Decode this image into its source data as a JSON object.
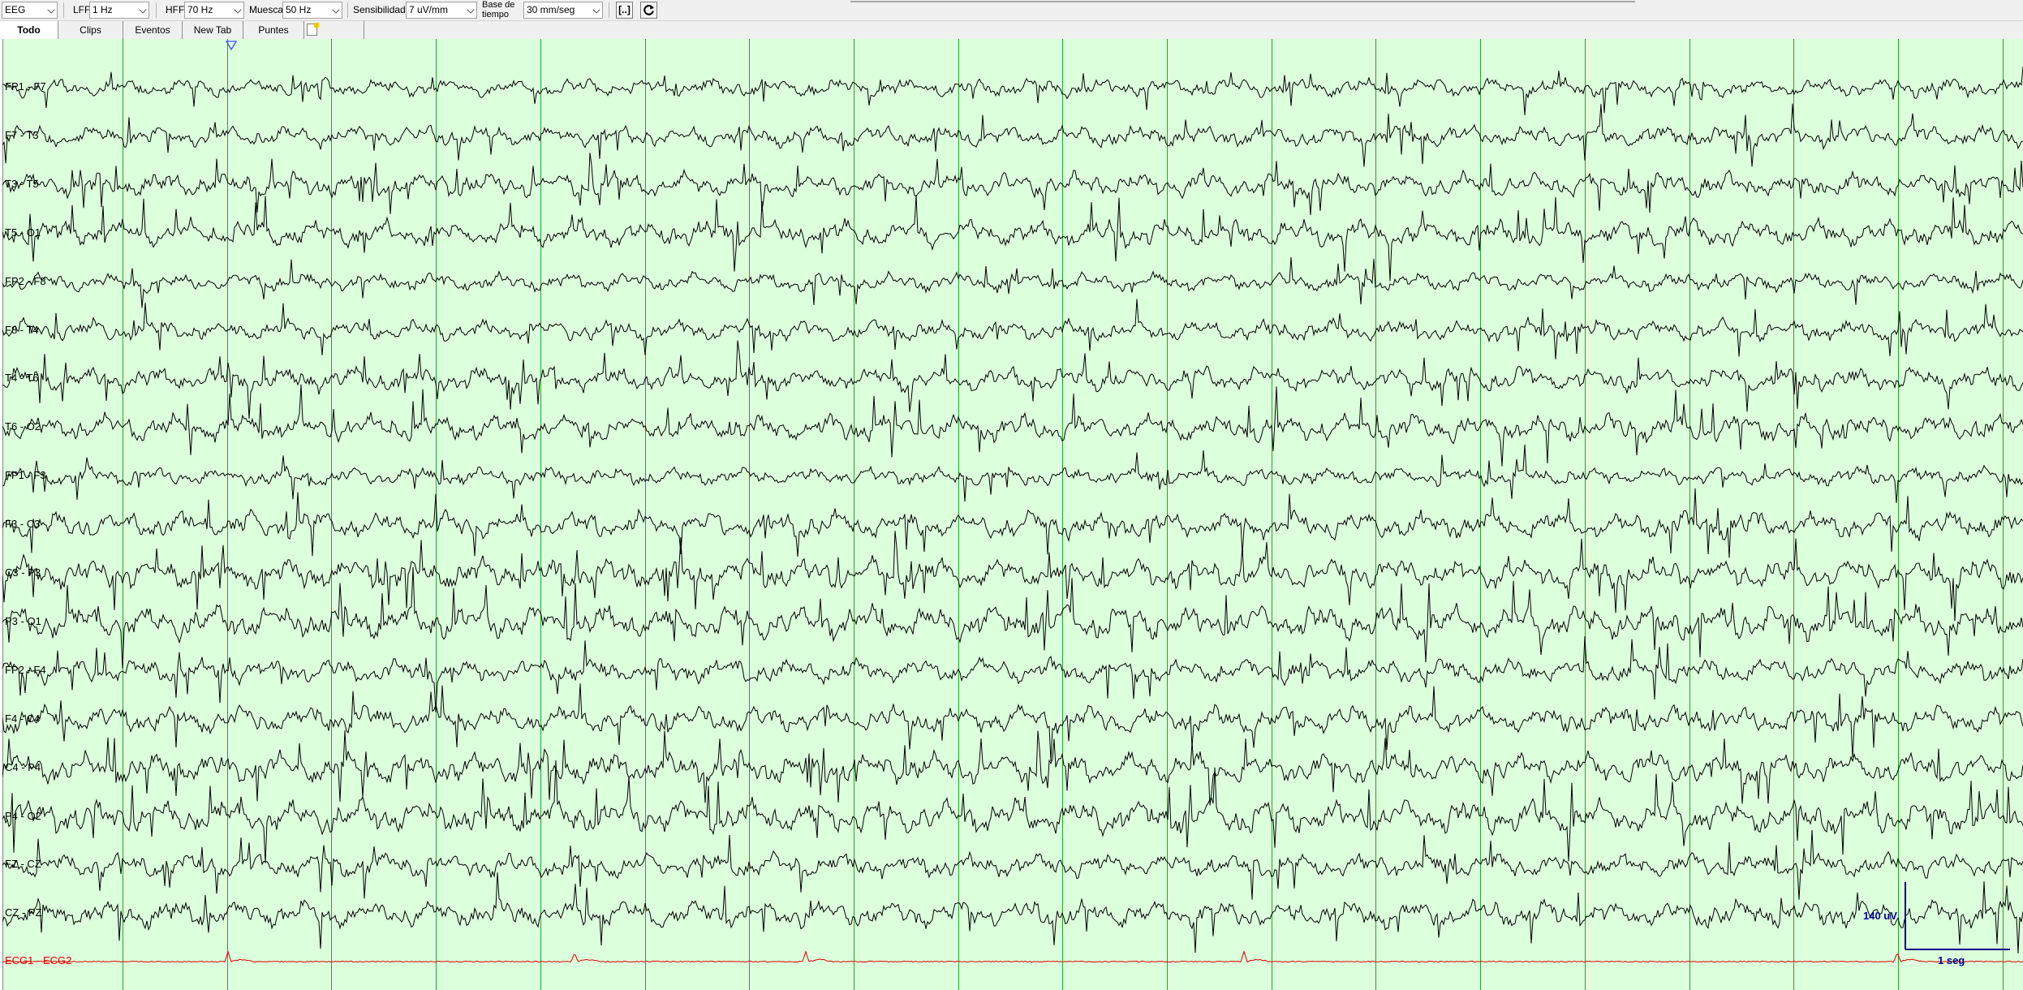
{
  "toolbar": {
    "montage": "EEG",
    "lff_label": "LFF",
    "lff_value": "1 Hz",
    "hff_label": "HFF",
    "hff_value": "70 Hz",
    "notch_label": "Muesca",
    "notch_value": "50 Hz",
    "sensitivity_label": "Sensibilidad",
    "sensitivity_value": "7 uV/mm",
    "timebase_label_line1": "Base de",
    "timebase_label_line2": "tiempo",
    "timebase_value": "30 mm/seg",
    "bracket_button": "[..]",
    "refresh_icon": "refresh-icon"
  },
  "tabs": [
    {
      "label": "Todo",
      "active": true
    },
    {
      "label": "Clips"
    },
    {
      "label": "Eventos"
    },
    {
      "label": "New Tab"
    },
    {
      "label": "Puntes"
    }
  ],
  "new_tab_icon": "new-document-icon",
  "channels": [
    "FP1 - F7",
    "F7 - T3",
    "T3 - T5",
    "T5 - O1",
    "FP2 - F8",
    "F8 - T4",
    "T4 - T6",
    "T6 - O2",
    "FP1 - F3",
    "F3 - C3",
    "C3 - P3",
    "P3 - O1",
    "FP2 - F4",
    "F4 - C4",
    "C4 - P4",
    "P4 - O2",
    "FZ - CZ",
    "CZ - PZ"
  ],
  "ecg_channel": "ECG1 - ECG2",
  "calibration": {
    "amplitude_label": "140 uV",
    "time_label": "1 seg"
  },
  "colors": {
    "background": "#dcffdc",
    "second_gridline": "#2e9e2e",
    "trace": "#000000",
    "ecg_trace": "#e00000",
    "calibration": "#00008b",
    "marker": "#3a50ff"
  }
}
